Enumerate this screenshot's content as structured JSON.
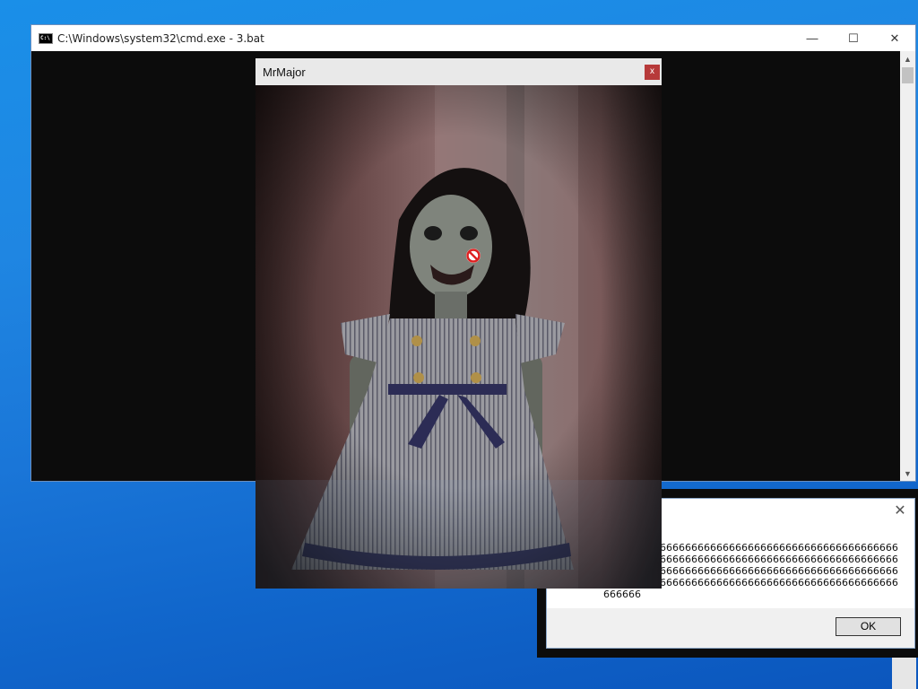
{
  "cmd_window": {
    "title": "C:\\Windows\\system32\\cmd.exe - 3.bat",
    "icon": "console-icon",
    "icon_text": "C:\\",
    "minimize": "—",
    "maximize": "☐",
    "close": "✕",
    "scroll_up": "▲",
    "scroll_down": "▼"
  },
  "image_window": {
    "title": "MrMajor",
    "close_label": "x",
    "image": "creepy-doll-image",
    "badge_icon": "prohibited-icon"
  },
  "message_box": {
    "close": "✕",
    "text": "66666666666666666666666666666666666666666666666666666666666666666666666666666666666666666666666666666666666666666666666666666666666666666666666666666666666666666666666666666666666666666666666666",
    "ok_label": "OK"
  },
  "colors": {
    "desktop": "#1a7ad8",
    "console_bg": "#0c0c0c",
    "close_red": "#b73a3a"
  }
}
